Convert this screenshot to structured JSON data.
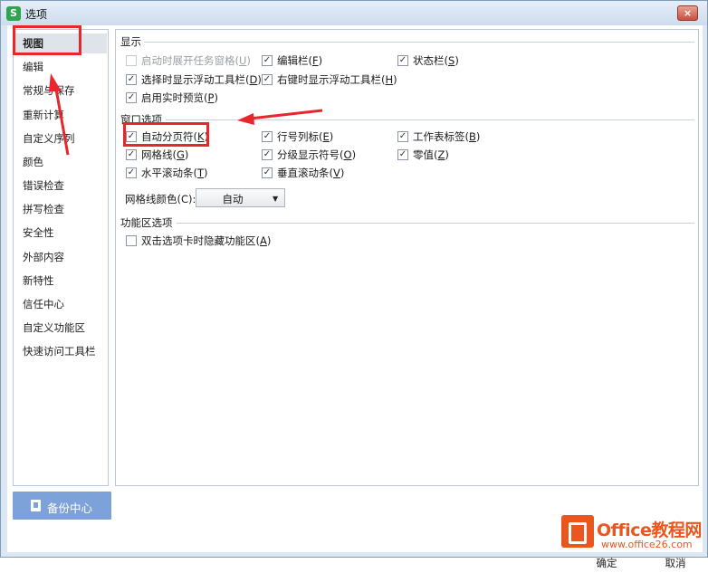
{
  "window": {
    "title": "选项",
    "app_icon": "S",
    "close_label": "×"
  },
  "sidebar": {
    "items": [
      {
        "label": "视图",
        "active": true
      },
      {
        "label": "编辑"
      },
      {
        "label": "常规与保存"
      },
      {
        "label": "重新计算"
      },
      {
        "label": "自定义序列"
      },
      {
        "label": "颜色"
      },
      {
        "label": "错误检查"
      },
      {
        "label": "拼写检查"
      },
      {
        "label": "安全性"
      },
      {
        "label": "外部内容"
      },
      {
        "label": "新特性"
      },
      {
        "label": "信任中心"
      },
      {
        "label": "自定义功能区"
      },
      {
        "label": "快速访问工具栏"
      }
    ],
    "backup_button": "备份中心"
  },
  "sections": {
    "display": {
      "title": "显示",
      "options": [
        {
          "text": "启动时展开任务窗格",
          "key": "U",
          "checked": false,
          "disabled": true
        },
        {
          "text": "编辑栏",
          "key": "F",
          "checked": true
        },
        {
          "text": "状态栏",
          "key": "S",
          "checked": true
        },
        {
          "text": "选择时显示浮动工具栏",
          "key": "D",
          "checked": true
        },
        {
          "text": "右键时显示浮动工具栏",
          "key": "H",
          "checked": true
        },
        {
          "text": "启用实时预览",
          "key": "P",
          "checked": true
        }
      ]
    },
    "window_options": {
      "title": "窗口选项",
      "options": [
        {
          "text": "自动分页符",
          "key": "K",
          "checked": true
        },
        {
          "text": "行号列标",
          "key": "E",
          "checked": true
        },
        {
          "text": "工作表标签",
          "key": "B",
          "checked": true
        },
        {
          "text": "网格线",
          "key": "G",
          "checked": true
        },
        {
          "text": "分级显示符号",
          "key": "O",
          "checked": true
        },
        {
          "text": "零值",
          "key": "Z",
          "checked": true
        },
        {
          "text": "水平滚动条",
          "key": "T",
          "checked": true
        },
        {
          "text": "垂直滚动条",
          "key": "V",
          "checked": true
        }
      ],
      "gridline_color_label": "网格线颜色(C):",
      "gridline_color_value": "自动"
    },
    "ribbon": {
      "title": "功能区选项",
      "options": [
        {
          "text": "双击选项卡时隐藏功能区",
          "key": "A",
          "checked": false
        }
      ]
    }
  },
  "footer": {
    "ok_label": "确定",
    "cancel_label": "取消"
  },
  "watermark": {
    "title": "Office教程网",
    "url": "www.office26.com"
  },
  "colors": {
    "highlight": "#e8262b",
    "sidebar_active": "#dfe4ea",
    "backup_button": "#7da2d9",
    "watermark": "#e8571f"
  }
}
